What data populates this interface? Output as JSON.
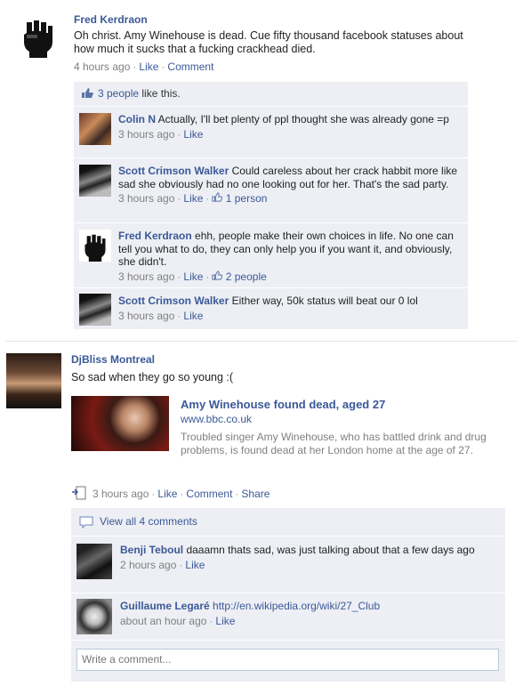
{
  "post1": {
    "author": "Fred Kerdraon",
    "text": "Oh christ. Amy Winehouse is dead. Cue fifty thousand facebook statuses about how much it sucks that a fucking crackhead died.",
    "time": "4 hours ago",
    "like_label": "Like",
    "comment_label": "Comment",
    "likes_count_link": "3 people",
    "likes_suffix": " like this.",
    "comments": [
      {
        "author": "Colin N",
        "text": "Actually, I'll bet plenty of ppl thought she was already gone =p",
        "time": "3 hours ago",
        "like_label": "Like",
        "likes": ""
      },
      {
        "author": "Scott Crimson Walker",
        "text": "Could careless about her crack habbit more like sad she obviously had no one looking out for her. That's the sad party.",
        "time": "3 hours ago",
        "like_label": "Like",
        "likes": "1 person"
      },
      {
        "author": "Fred Kerdraon",
        "text": "ehh, people make their own choices in life. No one can tell you what to do, they can only help you if you want it, and obviously, she didn't.",
        "time": "3 hours ago",
        "like_label": "Like",
        "likes": "2 people"
      },
      {
        "author": "Scott Crimson Walker",
        "text": "Either way, 50k status will beat our 0 lol",
        "time": "3 hours ago",
        "like_label": "Like",
        "likes": ""
      }
    ]
  },
  "post2": {
    "author": "DjBliss Montreal",
    "text": "So sad when they go so young :(",
    "share": {
      "title": "Amy Winehouse found dead, aged 27",
      "url": "www.bbc.co.uk",
      "description": "Troubled singer Amy Winehouse, who has battled drink and drug problems, is found dead at her London home at the age of 27."
    },
    "time": "3 hours ago",
    "like_label": "Like",
    "comment_label": "Comment",
    "share_label": "Share",
    "view_all": "View all 4 comments",
    "comments": [
      {
        "author": "Benji Teboul",
        "text": "daaamn thats sad, was just talking about that a few days ago",
        "time": "2 hours ago",
        "like_label": "Like"
      },
      {
        "author": "Guillaume Legaré",
        "text": "http://en.wikipedia.org/wiki/27_Club",
        "time": "about an hour ago",
        "like_label": "Like"
      }
    ],
    "comment_placeholder": "Write a comment..."
  },
  "colors": {
    "link": "#3b5998",
    "ufi_bg": "#edeff4",
    "meta": "#808080"
  }
}
